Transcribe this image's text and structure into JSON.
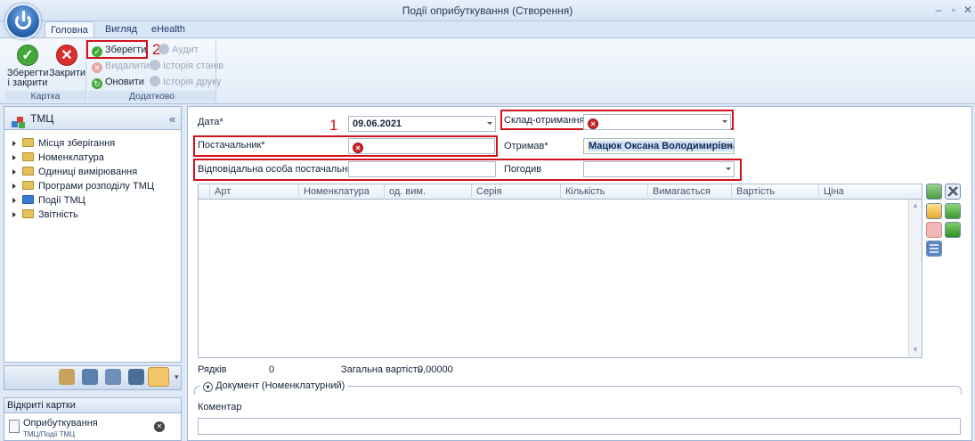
{
  "window": {
    "title": "Події оприбуткування (Створення)",
    "controls": [
      "–",
      "▫",
      "✕"
    ]
  },
  "tabs": [
    {
      "label": "Головна",
      "active": true
    },
    {
      "label": "Вигляд",
      "active": false
    },
    {
      "label": "eHealth",
      "active": false
    }
  ],
  "ribbon": {
    "group_card": {
      "label": "Картка",
      "save_close": "Зберегти\nі закрити",
      "close": "Закрити"
    },
    "group_extra": {
      "label": "Додатково",
      "save": "Зберегти",
      "delete": "Видалити",
      "refresh": "Оновити",
      "audit": "Аудит",
      "status_history": "Історія станів",
      "print_history": "Історія друку"
    }
  },
  "annotations": {
    "one": "1",
    "two": "2"
  },
  "left_panel": {
    "title": "ТМЦ",
    "collapse": "«",
    "tree": [
      {
        "label": "Місця зберігання"
      },
      {
        "label": "Номенклатура"
      },
      {
        "label": "Одиниці вимірювання"
      },
      {
        "label": "Програми розподілу ТМЦ"
      },
      {
        "label": "Події ТМЦ"
      },
      {
        "label": "Звітність"
      }
    ]
  },
  "open_cards": {
    "title": "Відкриті картки",
    "items": [
      {
        "title": "Оприбуткування",
        "subtitle": "ТМЦ/Події ТМЦ"
      }
    ]
  },
  "form": {
    "date_label": "Дата*",
    "date_value": "09.06.2021",
    "warehouse_label": "Склад-отримання*",
    "warehouse_value": "",
    "supplier_label": "Постачальник*",
    "supplier_value": "",
    "received_label": "Отримав*",
    "received_value": "Мацюк Оксана Володимирівна",
    "responsible_label": "Відповідальна особа постачальника",
    "responsible_value": "",
    "approved_label": "Погодив",
    "approved_value": ""
  },
  "grid": {
    "columns": [
      "Арт",
      "Номенклатура",
      "од. вим.",
      "Серія",
      "Кількість",
      "Вимагається",
      "Вартість",
      "Ціна"
    ],
    "rows": []
  },
  "summary": {
    "rows_label": "Рядків",
    "rows_value": "0",
    "total_label": "Загальна вартість",
    "total_value": "0,00000"
  },
  "document_section": "Документ (Номенклатурний)",
  "comment_label": "Коментар",
  "comment_value": "",
  "colors": {
    "highlight_border": "#d0121c",
    "accent": "#2b67b5",
    "error": "#c9262b"
  }
}
